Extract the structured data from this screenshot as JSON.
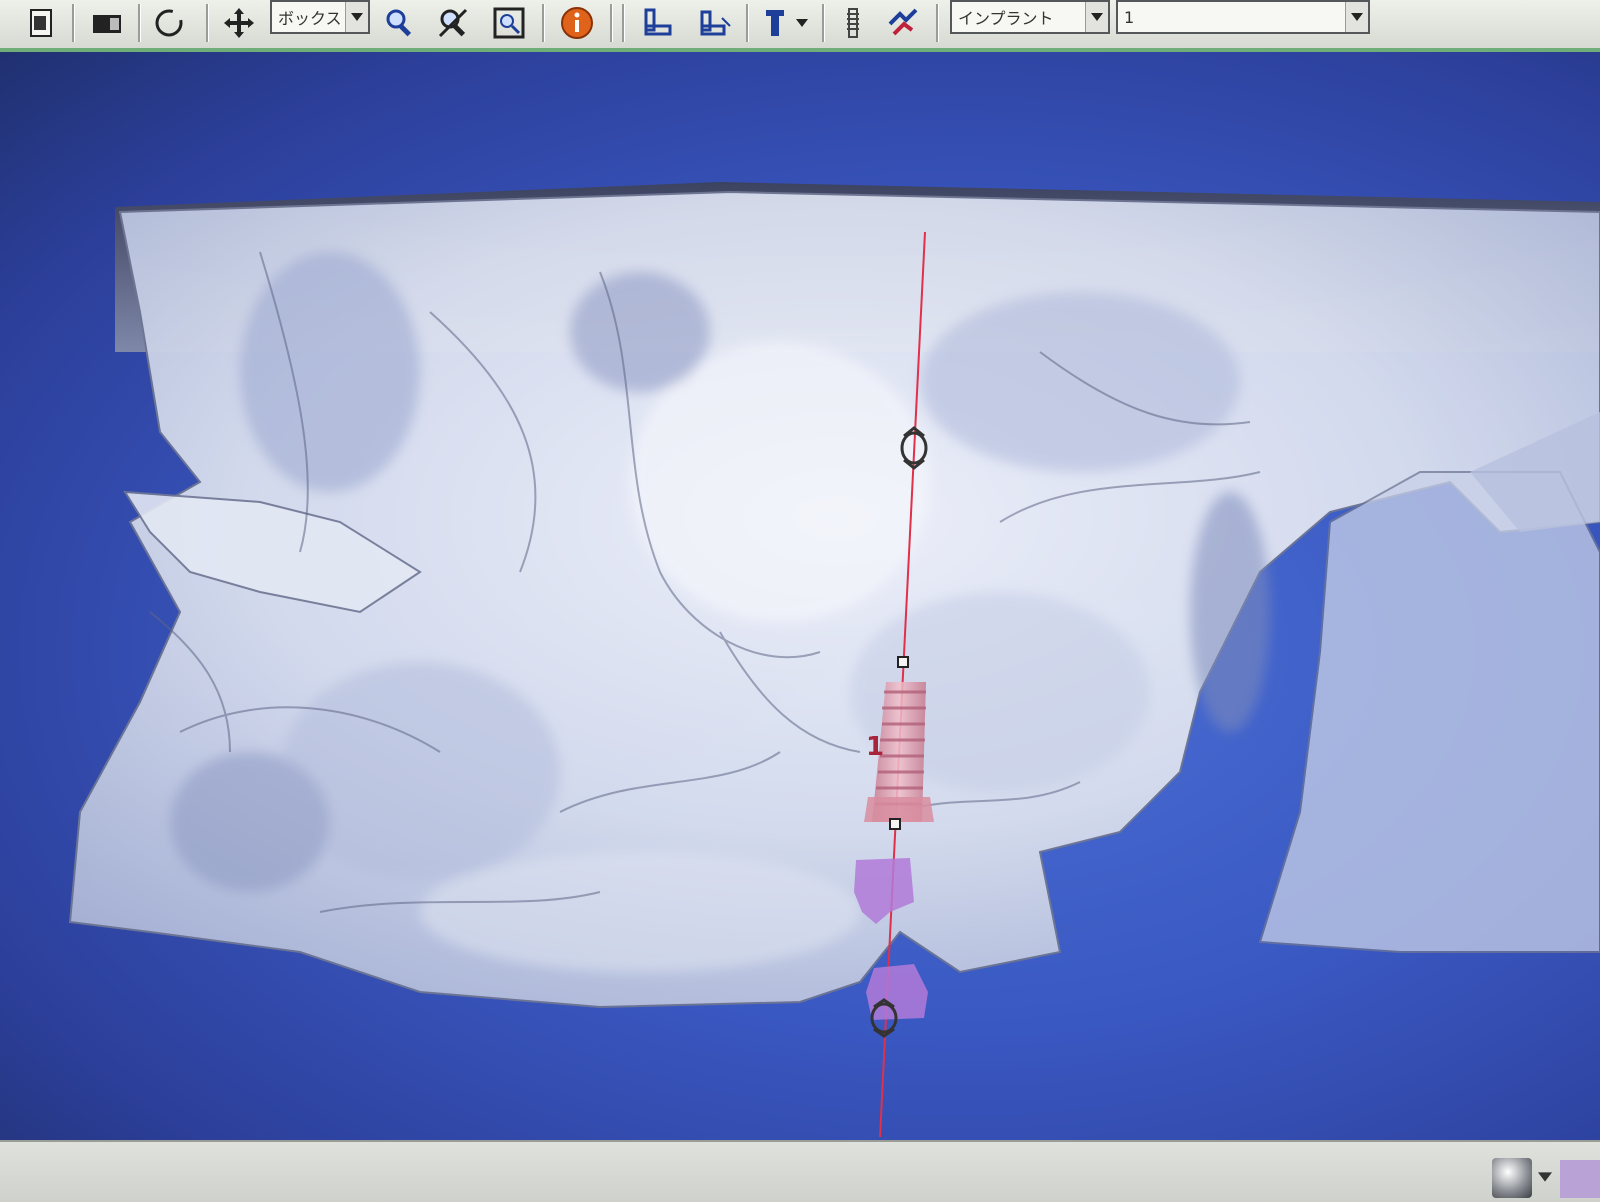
{
  "toolbar": {
    "buttons": [
      {
        "id": "file",
        "icon": "document-icon"
      },
      {
        "id": "display",
        "icon": "panel-icon"
      },
      {
        "id": "rotate",
        "icon": "rotate-icon"
      },
      {
        "id": "pan",
        "icon": "move-icon"
      },
      {
        "id": "zoom",
        "icon": "magnifier-icon"
      },
      {
        "id": "zoom-fit",
        "icon": "magnifier-cross-icon"
      },
      {
        "id": "zoom-window",
        "icon": "zoom-window-icon"
      },
      {
        "id": "info",
        "icon": "info-icon"
      },
      {
        "id": "view-a",
        "icon": "chair-view-icon"
      },
      {
        "id": "view-b",
        "icon": "chair-view-alt-icon"
      },
      {
        "id": "implant-tool",
        "icon": "implant-tool-icon"
      },
      {
        "id": "implant-detail",
        "icon": "implant-detail-icon"
      },
      {
        "id": "nerve-tool",
        "icon": "nerve-tool-icon"
      }
    ],
    "mode_select": {
      "value": "ボックス"
    },
    "object_select": {
      "value": "インプラント"
    },
    "number_select": {
      "value": "1"
    }
  },
  "viewport": {
    "implant_number": "1",
    "colors": {
      "background": "#3a58c2",
      "bone": "#dfe4f2",
      "implant": "#e6a6b6",
      "abutment": "#b27ad8",
      "axis_line": "#e0304a"
    }
  },
  "status": {
    "icon": "sphere-icon",
    "swatch_color": "#b8a2d6"
  }
}
